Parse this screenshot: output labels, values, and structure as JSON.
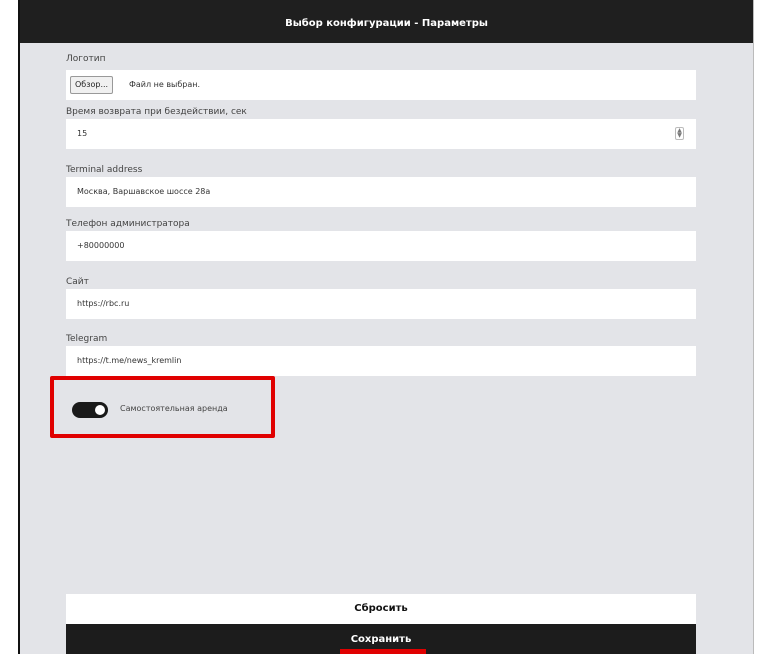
{
  "header": {
    "title": "Выбор конфигурации - Параметры"
  },
  "form": {
    "logo": {
      "label": "Логотип",
      "browse_label": "Обзор...",
      "file_status": "Файл не выбран."
    },
    "idle_return": {
      "label": "Время возврата при бездействии, сек",
      "value": "15"
    },
    "terminal_address": {
      "label": "Terminal address",
      "value": "Москва, Варшавское шоссе 28а"
    },
    "admin_phone": {
      "label": "Телефон администратора",
      "value": "+80000000"
    },
    "site": {
      "label": "Сайт",
      "value": "https://rbc.ru"
    },
    "telegram": {
      "label": "Telegram",
      "value": "https://t.me/news_kremlin"
    },
    "self_rental": {
      "label": "Самостоятельная аренда",
      "enabled": true
    }
  },
  "actions": {
    "reset_label": "Сбросить",
    "save_label": "Сохранить"
  },
  "colors": {
    "accent_highlight": "#e00000",
    "header_bg": "#1f1f1f",
    "panel_bg": "#e3e4e8"
  },
  "icons": {
    "spinner": "number-spinner-icon"
  }
}
